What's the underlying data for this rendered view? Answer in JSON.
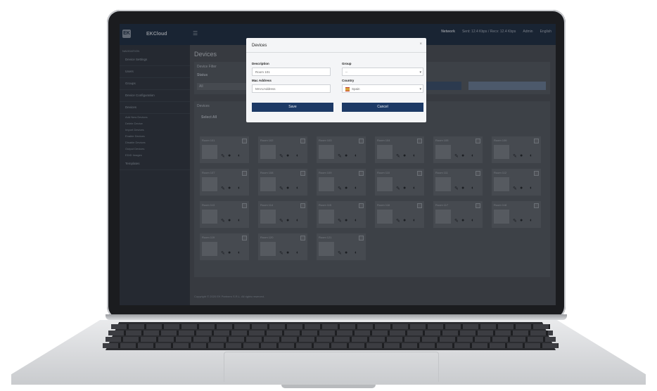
{
  "app": {
    "logo_text": "EK",
    "brand": "EKCloud",
    "menu_icon": "hamburger-icon",
    "network_label": "Network",
    "network_stats": "Sent: 12.4 Kbps / Recv: 12.4 Kbps",
    "admin_label": "Admin",
    "language": "English"
  },
  "sidebar": {
    "header": "NAVIGATION",
    "items": [
      {
        "label": "Device Settings",
        "icon": "settings-icon"
      },
      {
        "label": "Users",
        "icon": "users-icon"
      },
      {
        "label": "Groups",
        "icon": "folder-icon"
      },
      {
        "label": "Device Configuration",
        "icon": "config-icon"
      },
      {
        "label": "Devices",
        "icon": "device-icon"
      }
    ],
    "subitems": [
      "Add New Devices",
      "Delete Device",
      "Import Devices",
      "Enable Devices",
      "Disable Devices",
      "Output Devices",
      "EDID Images"
    ],
    "extra": "Templates"
  },
  "page": {
    "title": "Devices",
    "filter_title": "Device Filter",
    "filter_status_label": "Status",
    "filter_status_value": "All",
    "devices_label": "Devices",
    "select_all": "Select All",
    "footer": "Copyright © 2020 EK Partners S.R.L. All rights reserved."
  },
  "device_cards": [
    {
      "name": "Room 101"
    },
    {
      "name": "Room 102"
    },
    {
      "name": "Room 103"
    },
    {
      "name": "Room 104"
    },
    {
      "name": "Room 105"
    },
    {
      "name": "Room 106"
    },
    {
      "name": "Room 107"
    },
    {
      "name": "Room 108"
    },
    {
      "name": "Room 109"
    },
    {
      "name": "Room 110"
    },
    {
      "name": "Room 111"
    },
    {
      "name": "Room 112"
    },
    {
      "name": "Room 113"
    },
    {
      "name": "Room 114"
    },
    {
      "name": "Room 115"
    },
    {
      "name": "Room 116"
    },
    {
      "name": "Room 117"
    },
    {
      "name": "Room 118"
    },
    {
      "name": "Room 119"
    },
    {
      "name": "Room 120"
    },
    {
      "name": "Room 121"
    }
  ],
  "modal": {
    "title": "Devices",
    "close_icon": "close-icon",
    "description_label": "Description",
    "description_value": "Room 101",
    "group_label": "Group",
    "group_value": "--",
    "mac_label": "Mac Address",
    "mac_value": "MAAcAddress",
    "country_label": "Country",
    "country_value": "Spain",
    "save_label": "Save",
    "cancel_label": "Cancel"
  }
}
